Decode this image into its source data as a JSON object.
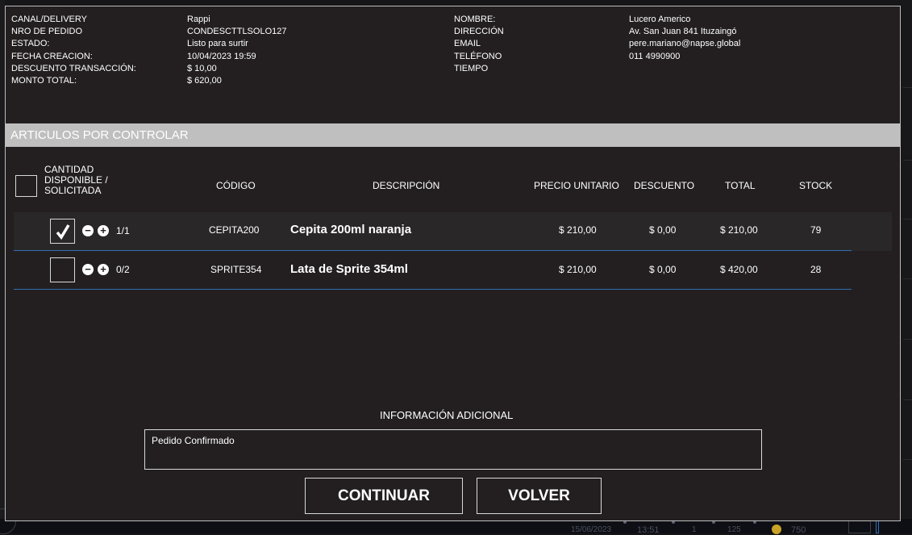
{
  "order": {
    "labels": [
      "CANAL/DELIVERY",
      "NRO DE PEDIDO",
      "ESTADO:",
      "FECHA CREACION:",
      "DESCUENTO TRANSACCIÓN:",
      "MONTO TOTAL:"
    ],
    "values": [
      "Rappi",
      "CONDESCTTLSOLO127",
      "Listo para surtir",
      "10/04/2023 19:59",
      "$ 10,00",
      "$ 620,00"
    ]
  },
  "customer": {
    "labels": [
      "NOMBRE:",
      "DIRECCIÓN",
      "EMAIL",
      "TELÉFONO",
      "TIEMPO"
    ],
    "values": [
      "Lucero Americo",
      "Av. San Juan 841 Ituzaingó",
      "pere.mariano@napse.global",
      "011 4990900",
      ""
    ]
  },
  "section_title": "ARTICULOS POR CONTROLAR",
  "table": {
    "headers": {
      "cantidad": "CANTIDAD DISPONIBLE / SOLICITADA",
      "codigo": "CÓDIGO",
      "descripcion": "DESCRIPCIÓN",
      "precio": "PRECIO UNITARIO",
      "descuento": "DESCUENTO",
      "total": "TOTAL",
      "stock": "STOCK"
    },
    "rows": [
      {
        "checked": true,
        "qty": "1/1",
        "codigo": "CEPITA200",
        "descripcion": "Cepita 200ml naranja",
        "precio": "$ 210,00",
        "descuento": "$ 0,00",
        "total": "$ 210,00",
        "stock": "79"
      },
      {
        "checked": false,
        "qty": "0/2",
        "codigo": "SPRITE354",
        "descripcion": "Lata de Sprite 354ml",
        "precio": "$ 210,00",
        "descuento": "$ 0,00",
        "total": "$ 420,00",
        "stock": "28"
      }
    ]
  },
  "additional": {
    "title": "INFORMACIÓN ADICIONAL",
    "text": "Pedido Confirmado"
  },
  "buttons": {
    "continue": "CONTINUAR",
    "back": "VOLVER"
  },
  "background": {
    "date": "15/06/2023",
    "time": "13:51",
    "count_a": "1",
    "count_b": "125",
    "count_c": "750"
  },
  "colors": {
    "modal_bg": "#231f20",
    "section_bar": "#bfbfbf",
    "row_divider": "#2f6fb5"
  }
}
